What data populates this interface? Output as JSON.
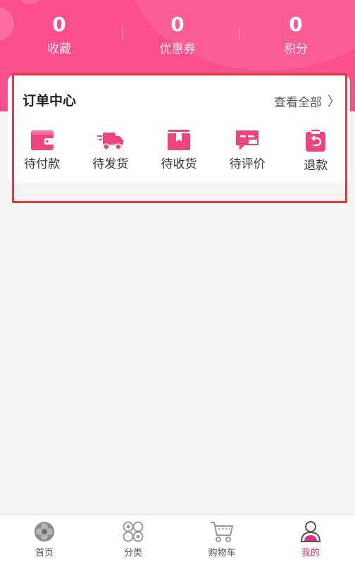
{
  "stats": [
    {
      "value": "0",
      "label": "收藏"
    },
    {
      "value": "0",
      "label": "优惠券"
    },
    {
      "value": "0",
      "label": "积分"
    }
  ],
  "order_center": {
    "title": "订单中心",
    "view_all": "查看全部",
    "items": [
      {
        "label": "待付款",
        "icon": "wallet-icon"
      },
      {
        "label": "待发货",
        "icon": "truck-icon"
      },
      {
        "label": "待收货",
        "icon": "box-icon"
      },
      {
        "label": "待评价",
        "icon": "comment-icon"
      },
      {
        "label": "退款",
        "icon": "refund-icon"
      }
    ]
  },
  "tabbar": {
    "items": [
      {
        "label": "首页",
        "icon": "home-flower-icon"
      },
      {
        "label": "分类",
        "icon": "category-icon"
      },
      {
        "label": "购物车",
        "icon": "cart-icon"
      },
      {
        "label": "我的",
        "icon": "user-icon",
        "active": true
      }
    ]
  },
  "colors": {
    "brand": "#fb4f8b",
    "icon": "#f0447e",
    "active_tab": "#e52c83",
    "highlight": "#e8393c"
  }
}
